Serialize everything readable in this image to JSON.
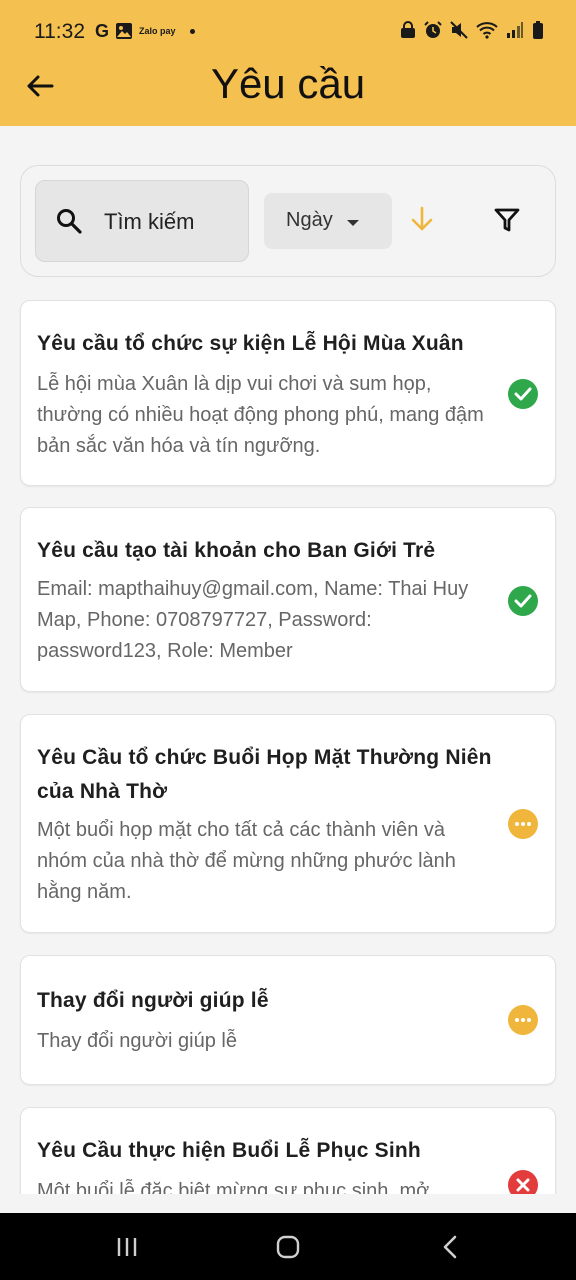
{
  "status_bar": {
    "time": "11:32",
    "zalo_label": "Zalo pay"
  },
  "header": {
    "title": "Yêu cầu"
  },
  "toolbar": {
    "search_placeholder": "Tìm kiếm",
    "sort_field": "Ngày"
  },
  "requests": [
    {
      "title": "Yêu cầu tổ chức sự kiện Lễ Hội Mùa Xuân",
      "description": "Lễ hội mùa Xuân là dịp vui chơi và sum họp, thường có nhiều hoạt động phong phú, mang đậm bản sắc văn hóa và tín ngưỡng.",
      "status": "approved"
    },
    {
      "title": "Yêu cầu tạo tài khoản cho Ban Giới Trẻ",
      "description": "Email: mapthaihuy@gmail.com, Name: Thai Huy Map, Phone: 0708797727, Password: password123, Role: Member",
      "status": "approved"
    },
    {
      "title": "Yêu Cầu tổ chức Buổi Họp Mặt Thường Niên của Nhà Thờ",
      "description": "Một buổi họp mặt cho tất cả các thành viên và nhóm của nhà thờ để mừng những phước lành hằng năm.",
      "status": "pending"
    },
    {
      "title": "Thay đổi người giúp lễ",
      "description": "Thay đổi người giúp lễ",
      "status": "pending"
    },
    {
      "title": "Yêu Cầu thực hiện Buổi Lễ Phục Sinh",
      "description": "Một buổi lễ đặc biệt mừng sự phục sinh, mở",
      "status": "rejected"
    }
  ],
  "colors": {
    "accent": "#f4c04f",
    "approved": "#2ea84a",
    "pending": "#f0b63c",
    "rejected": "#e23c3c"
  }
}
